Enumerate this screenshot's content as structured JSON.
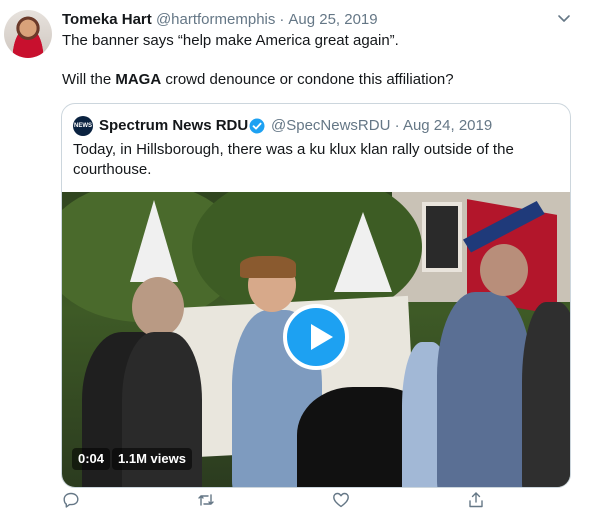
{
  "tweet": {
    "display_name": "Tomeka Hart",
    "handle": "@hartformemphis",
    "separator": "·",
    "date": "Aug 25, 2019",
    "text_line1": "The banner says “help make America great again”.",
    "text_line2_prefix": "Will the ",
    "text_line2_bold": "MAGA",
    "text_line2_suffix": " crowd denounce or condone this affiliation?"
  },
  "quoted_tweet": {
    "avatar_label": "NEWS",
    "display_name": "Spectrum News RDU",
    "handle": "@SpecNewsRDU",
    "separator": "·",
    "date": "Aug 24, 2019",
    "text": "Today, in Hillsborough, there was a ku klux klan rally outside of the courthouse."
  },
  "video": {
    "duration": "0:04",
    "views": "1.1M views"
  },
  "icons": {
    "reply": "reply-icon",
    "retweet": "retweet-icon",
    "like": "like-icon",
    "share": "share-icon",
    "caret": "chevron-down-icon",
    "verified": "verified-badge-icon",
    "play": "play-icon"
  },
  "colors": {
    "accent": "#1da1f2",
    "text": "#14171a",
    "secondary": "#657786",
    "border": "#ccd6dd"
  }
}
